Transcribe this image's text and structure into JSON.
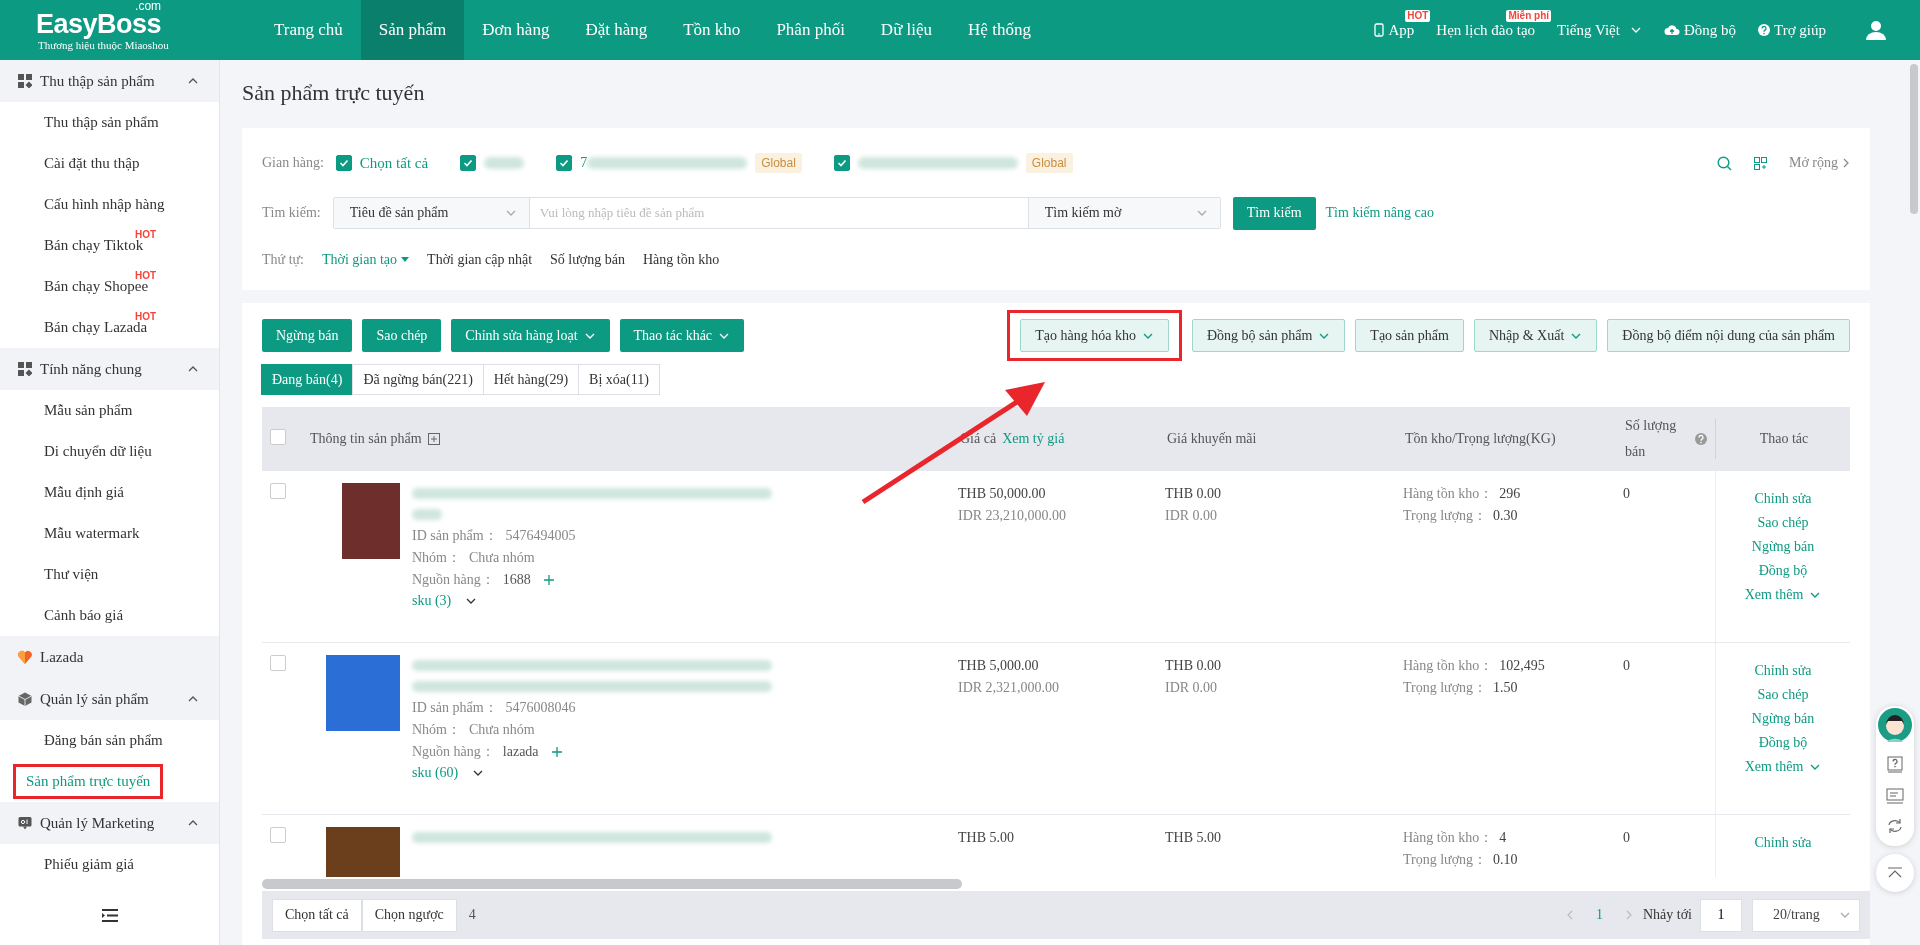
{
  "header": {
    "logo": "EasyBoss",
    "logo_domain": ".com",
    "tagline": "Thương hiệu thuộc Miaoshou",
    "nav": [
      {
        "label": "Trang chủ",
        "selected": false
      },
      {
        "label": "Sản phẩm",
        "selected": true
      },
      {
        "label": "Đơn hàng",
        "selected": false
      },
      {
        "label": "Đặt hàng",
        "selected": false
      },
      {
        "label": "Tồn kho",
        "selected": false
      },
      {
        "label": "Phân phối",
        "selected": false
      },
      {
        "label": "Dữ liệu",
        "selected": false
      },
      {
        "label": "Hệ thống",
        "selected": false
      }
    ],
    "tools": [
      {
        "kind": "app",
        "label": "App",
        "badge": "HOT"
      },
      {
        "kind": "link",
        "label": "Hẹn lịch đào tạo",
        "badge": "Miễn phí"
      },
      {
        "kind": "lang",
        "label": "Tiếng Việt"
      },
      {
        "kind": "sync",
        "label": "Đồng bộ"
      },
      {
        "kind": "help",
        "label": "Trợ giúp"
      },
      {
        "kind": "user"
      }
    ]
  },
  "sidebar": {
    "groups": [
      {
        "kind": "grid",
        "label": "Thu thập sản phẩm",
        "expanded": true,
        "items": [
          {
            "label": "Thu thập sản phẩm",
            "selected": false
          },
          {
            "label": "Cài đặt thu thập",
            "selected": false
          },
          {
            "label": "Cấu hình nhập hàng",
            "selected": false
          },
          {
            "label": "Bán chạy Tiktok",
            "badge": "HOT",
            "selected": false
          },
          {
            "label": "Bán chạy Shopee",
            "badge": "HOT",
            "selected": false
          },
          {
            "label": "Bán chạy Lazada",
            "badge": "HOT",
            "selected": false
          }
        ]
      },
      {
        "kind": "grid",
        "label": "Tính năng chung",
        "expanded": true,
        "items": [
          {
            "label": "Mẫu sản phẩm",
            "selected": false
          },
          {
            "label": "Di chuyển dữ liệu",
            "selected": false
          },
          {
            "label": "Mẫu định giá",
            "selected": false
          },
          {
            "label": "Mẫu watermark",
            "selected": false
          },
          {
            "label": "Thư viện",
            "selected": false
          },
          {
            "label": "Cảnh báo giá",
            "selected": false
          }
        ]
      },
      {
        "kind": "heart",
        "label": "Lazada"
      },
      {
        "kind": "box",
        "label": "Quản lý sản phẩm",
        "expanded": true,
        "items": [
          {
            "label": "Đăng bán sản phẩm",
            "selected": false
          },
          {
            "label": "Sản phẩm trực tuyến",
            "selected": true,
            "highlighted": true
          }
        ]
      },
      {
        "kind": "ad",
        "label": "Quản lý Marketing",
        "expanded": true,
        "items": [
          {
            "label": "Phiếu giảm giá",
            "selected": false
          }
        ]
      }
    ]
  },
  "page_title": "Sản phẩm trực tuyến",
  "filters": {
    "store_label": "Gian hàng:",
    "stores": [
      {
        "kind": "all",
        "label": "Chọn tất cả",
        "checked": true
      },
      {
        "kind": "masked",
        "checked": true
      },
      {
        "kind": "masked",
        "label": "7",
        "tag": "Global",
        "checked": true
      },
      {
        "kind": "masked",
        "tag": "Global",
        "checked": true
      }
    ],
    "expand": "Mở rộng",
    "search_label": "Tìm kiếm:",
    "search_field": "Tiêu đề sản phẩm",
    "search_placeholder": "Vui lòng nhập tiêu đề sản phẩm",
    "search_mode": "Tìm kiếm mờ",
    "search_button": "Tìm kiếm",
    "advanced": "Tìm kiếm nâng cao",
    "sort_label": "Thứ tự:",
    "sorts": [
      {
        "label": "Thời gian tạo",
        "selected": true
      },
      {
        "label": "Thời gian cập nhật",
        "selected": false
      },
      {
        "label": "Số lượng bán",
        "selected": false
      },
      {
        "label": "Hàng tồn kho",
        "selected": false
      }
    ]
  },
  "actions_left": [
    {
      "label": "Ngừng bán",
      "dropdown": false
    },
    {
      "label": "Sao chép",
      "dropdown": false
    },
    {
      "label": "Chỉnh sửa hàng loạt",
      "dropdown": true
    },
    {
      "label": "Thao tác khác",
      "dropdown": true
    }
  ],
  "actions_right": [
    {
      "label": "Tạo hàng hóa kho",
      "dropdown": true,
      "highlighted": true
    },
    {
      "label": "Đồng bộ sản phẩm",
      "dropdown": true,
      "highlighted": false
    },
    {
      "label": "Tạo sản phẩm",
      "dropdown": false,
      "highlighted": false
    },
    {
      "label": "Nhập & Xuất",
      "dropdown": true,
      "highlighted": false
    },
    {
      "label": "Đồng bộ điểm nội dung của sản phẩm",
      "dropdown": false,
      "highlighted": false
    }
  ],
  "tabs": [
    {
      "label": "Đang bán(4)",
      "selected": true
    },
    {
      "label": "Đã ngừng bán(221)",
      "selected": false
    },
    {
      "label": "Hết hàng(29)",
      "selected": false
    },
    {
      "label": "Bị xóa(11)",
      "selected": false
    }
  ],
  "table": {
    "all_checked": false,
    "columns": [
      {
        "kind": "product",
        "label": "Thông tin sản phẩm"
      },
      {
        "kind": "price",
        "label": "Giá cả",
        "link": "Xem tỷ giá"
      },
      {
        "kind": "plain",
        "label": "Giá khuyến mãi"
      },
      {
        "kind": "plain",
        "label": "Tồn kho/Trọng lượng(KG)"
      },
      {
        "kind": "help",
        "label": "Số lượng bán"
      },
      {
        "kind": "center",
        "label": "Thao tác"
      }
    ],
    "rows": [
      {
        "kind": "long",
        "selected": false,
        "id_label": "ID sản phẩm：",
        "id": "5476494005",
        "group_label": "Nhóm：",
        "group": "Chưa nhóm",
        "source_label": "Nguồn hàng：",
        "source": "1688",
        "sku": "sku (3)",
        "price": [
          "THB 50,000.00",
          "IDR 23,210,000.00"
        ],
        "promo": [
          "THB 0.00",
          "IDR 0.00"
        ],
        "stock_label": "Hàng tồn kho：",
        "stock": "296",
        "weight_label": "Trọng lượng：",
        "weight": "0.30",
        "sold": "0",
        "actions": [
          "Chỉnh sửa",
          "Sao chép",
          "Ngừng bán",
          "Đồng bộ"
        ],
        "more": "Xem thêm"
      },
      {
        "kind": "long",
        "selected": false,
        "id_label": "ID sản phẩm：",
        "id": "5476008046",
        "group_label": "Nhóm：",
        "group": "Chưa nhóm",
        "source_label": "Nguồn hàng：",
        "source": "lazada",
        "sku": "sku (60)",
        "price": [
          "THB 5,000.00",
          "IDR 2,321,000.00"
        ],
        "promo": [
          "THB 0.00",
          "IDR 0.00"
        ],
        "stock_label": "Hàng tồn kho：",
        "stock": "102,495",
        "weight_label": "Trọng lượng：",
        "weight": "1.50",
        "sold": "0",
        "actions": [
          "Chỉnh sửa",
          "Sao chép",
          "Ngừng bán",
          "Đồng bộ"
        ],
        "more": "Xem thêm"
      },
      {
        "kind": "short",
        "selected": false,
        "price": [
          "THB 5.00"
        ],
        "promo": [
          "THB 5.00"
        ],
        "stock_label": "Hàng tồn kho：",
        "stock": "4",
        "weight_label": "Trọng lượng：",
        "weight": "0.10",
        "sold": "0",
        "actions": [
          "Chỉnh sửa"
        ]
      }
    ]
  },
  "footer": {
    "select_all": "Chọn tất cả",
    "invert": "Chọn ngược",
    "count": "4",
    "page": "1",
    "jump_label": "Nhảy tới",
    "jump_value": "1",
    "page_size": "20/trang"
  }
}
